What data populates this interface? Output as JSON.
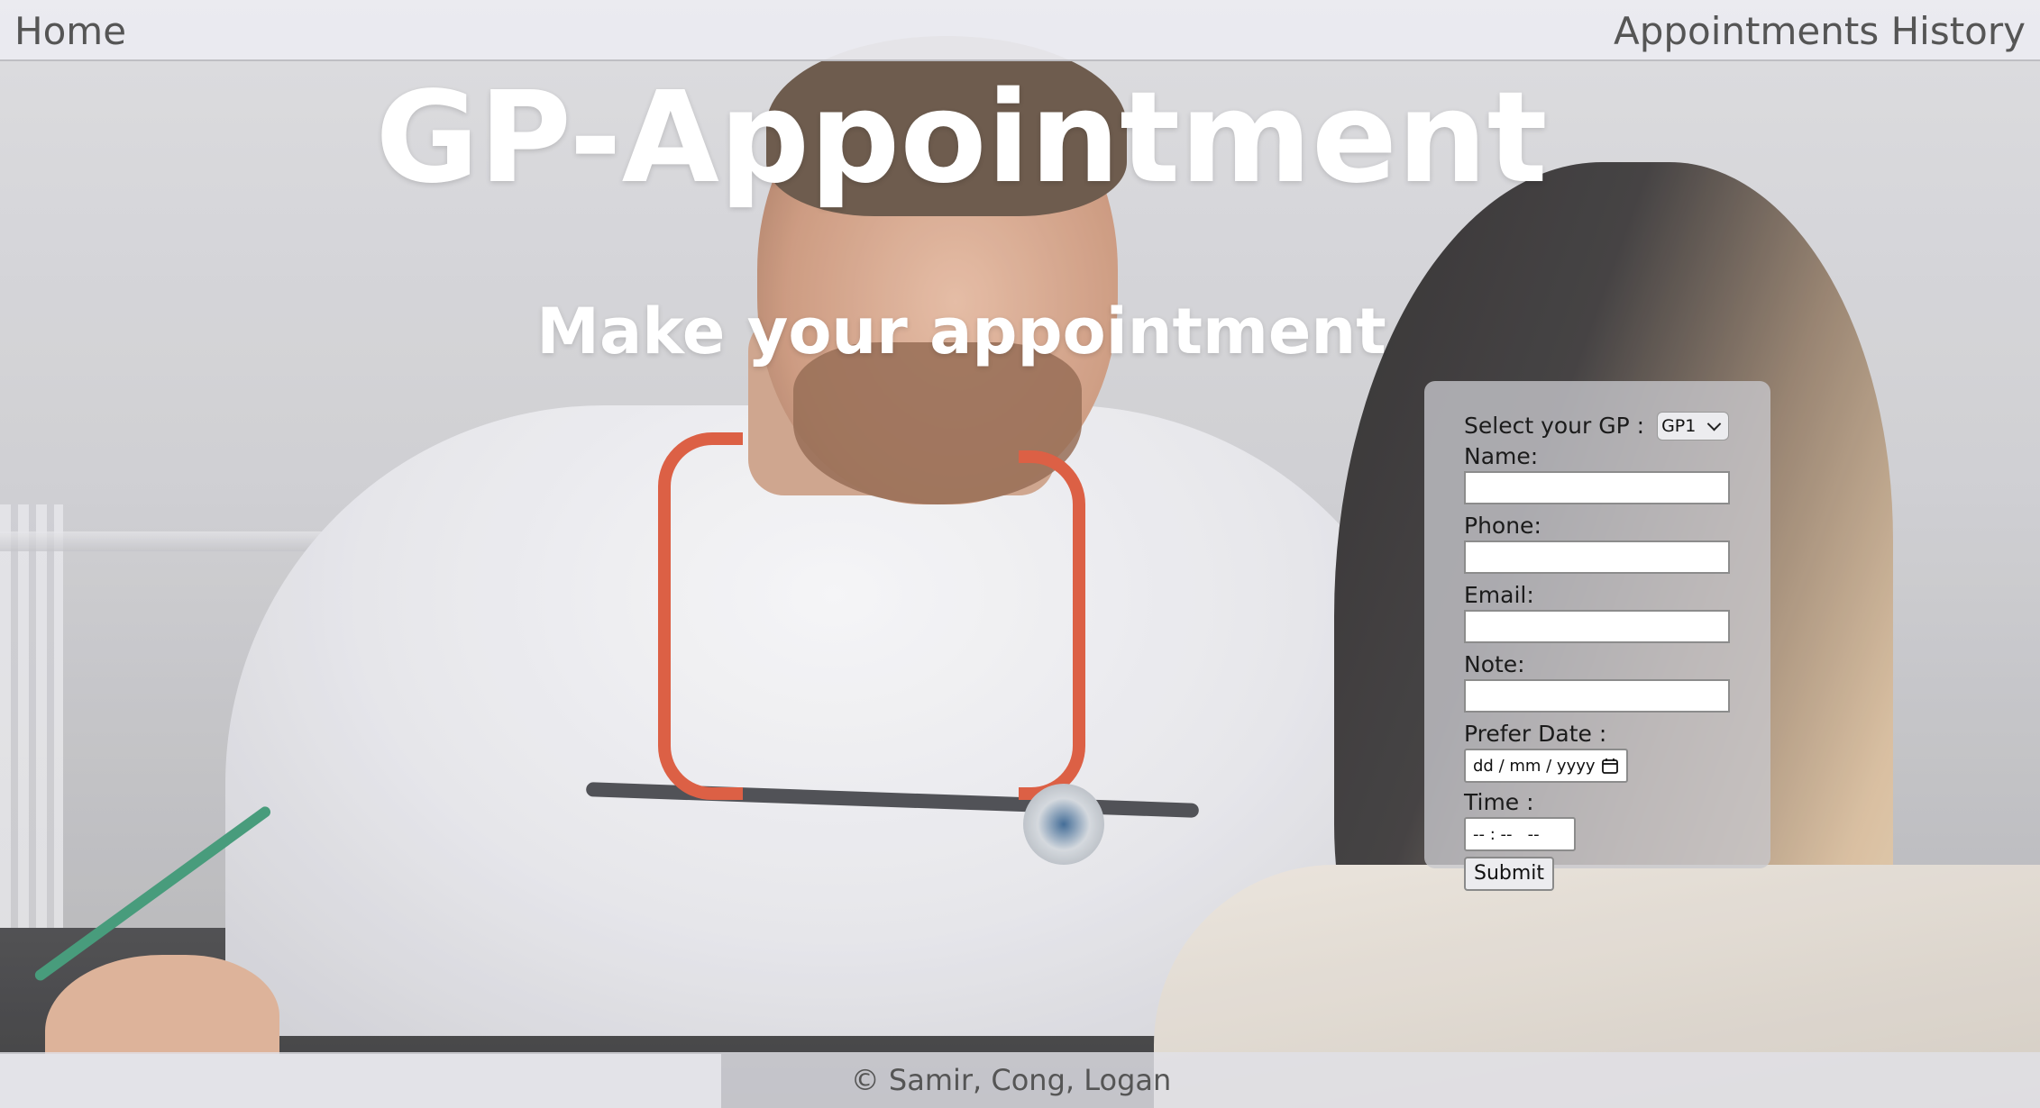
{
  "nav": {
    "home_label": "Home",
    "history_label": "Appointments History"
  },
  "hero": {
    "title": "GP-Appointment",
    "subtitle": "Make your appointment"
  },
  "form": {
    "gp_label": "Select your GP :",
    "gp_selected": "GP1",
    "name_label": "Name:",
    "name_value": "",
    "phone_label": "Phone:",
    "phone_value": "",
    "email_label": "Email:",
    "email_value": "",
    "note_label": "Note:",
    "note_value": "",
    "date_label": "Prefer Date :",
    "date_placeholder": "dd / mm / yyyy",
    "time_label": "Time :",
    "time_placeholder": "-- : --   --",
    "submit_label": "Submit"
  },
  "footer": {
    "credit": "© Samir, Cong, Logan"
  },
  "icons": {
    "gp_select": "chevron-down-icon",
    "date_picker": "calendar-icon"
  },
  "colors": {
    "heading": "#ffffff",
    "nav_text": "#555555",
    "panel_bg": "#c8c8cd"
  }
}
